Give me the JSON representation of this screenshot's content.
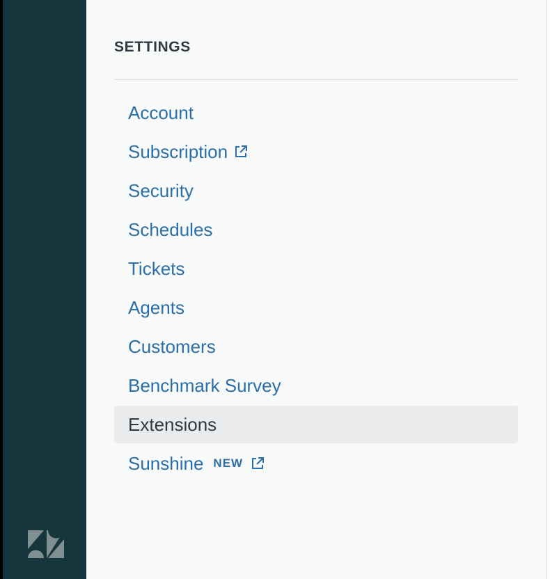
{
  "app": {
    "logo_icon": "zendesk-logo-icon"
  },
  "settings": {
    "heading": "SETTINGS",
    "items": [
      {
        "label": "Account",
        "external": false
      },
      {
        "label": "Subscription",
        "external": true,
        "icon": "external-link-icon"
      },
      {
        "label": "Security",
        "external": false
      },
      {
        "label": "Schedules",
        "external": false
      },
      {
        "label": "Tickets",
        "external": false
      },
      {
        "label": "Agents",
        "external": false
      },
      {
        "label": "Customers",
        "external": false
      },
      {
        "label": "Benchmark Survey",
        "external": false
      },
      {
        "label": "Extensions",
        "external": false,
        "selected": true
      },
      {
        "label": "Sunshine",
        "badge": "NEW",
        "external": true,
        "icon": "external-link-icon"
      }
    ]
  },
  "colors": {
    "rail": "#17353d",
    "panel": "#f8f9f9",
    "link": "#2b6ea8",
    "selected_bg": "#e9ebed",
    "heading": "#2f3941"
  }
}
